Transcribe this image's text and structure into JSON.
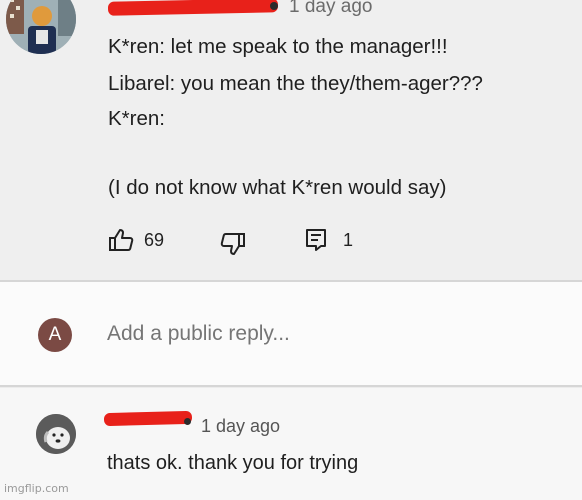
{
  "comment": {
    "timestamp": "1 day ago",
    "lines": [
      "K*ren: let me speak to the manager!!!",
      "Libarel: you mean the they/them-ager???",
      "K*ren:",
      "(I do not know what K*ren would say)"
    ],
    "actions": {
      "like_icon": "thumbs-up-icon",
      "like_count": "69",
      "dislike_icon": "thumbs-down-icon",
      "reply_icon": "reply-icon",
      "reply_count": "1"
    }
  },
  "reply_box": {
    "avatar_letter": "A",
    "placeholder": "Add a public reply..."
  },
  "reply": {
    "timestamp": "1 day ago",
    "text": "thats ok. thank you for trying"
  },
  "watermark": "imgflip.com",
  "colors": {
    "redaction": "#e8211a",
    "avatar_letter_bg": "#7b4a44"
  }
}
